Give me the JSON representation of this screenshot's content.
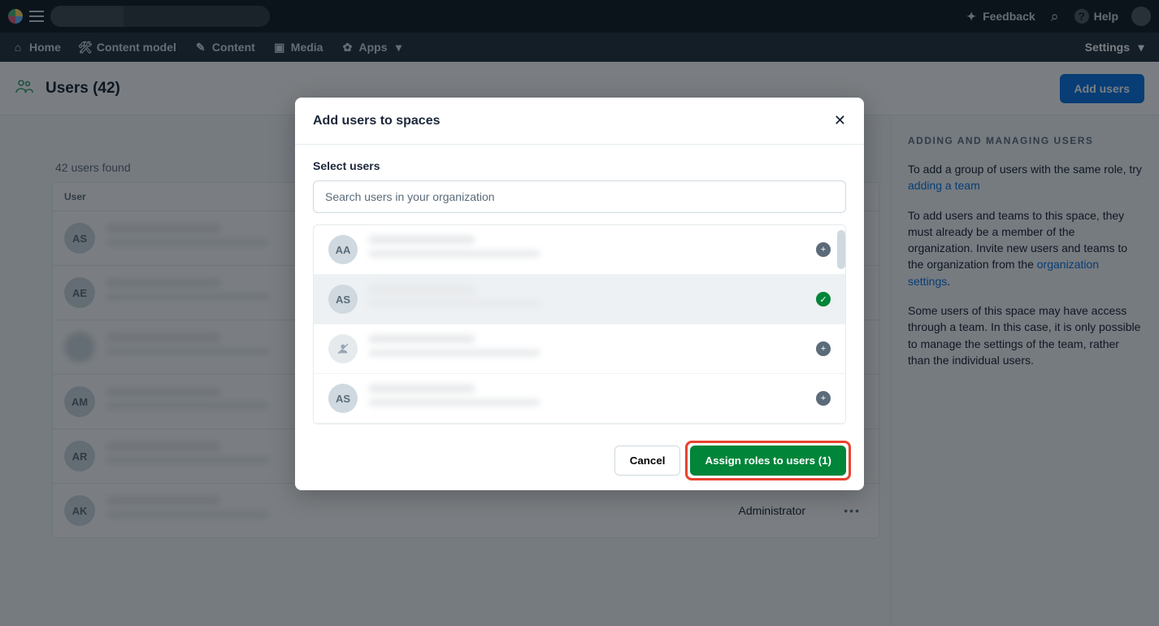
{
  "topbar": {
    "feedback": "Feedback",
    "help": "Help"
  },
  "secnav": {
    "home": "Home",
    "content_model": "Content model",
    "content": "Content",
    "media": "Media",
    "apps": "Apps",
    "settings": "Settings"
  },
  "page": {
    "title": "Users (42)",
    "add_users_btn": "Add users",
    "found": "42 users found",
    "col_user": "User"
  },
  "bg_users": [
    {
      "initials": "AS"
    },
    {
      "initials": "AE"
    },
    {
      "initials": ""
    },
    {
      "initials": "AM"
    },
    {
      "initials": "AR"
    },
    {
      "initials": "AK",
      "role": "Administrator"
    }
  ],
  "modal": {
    "title": "Add users to spaces",
    "select_label": "Select users",
    "search_placeholder": "Search users in your organization",
    "cancel": "Cancel",
    "assign": "Assign roles to users (1)",
    "list": [
      {
        "initials": "AA",
        "selected": false,
        "nouser": false
      },
      {
        "initials": "AS",
        "selected": true,
        "nouser": false
      },
      {
        "initials": "",
        "selected": false,
        "nouser": true
      },
      {
        "initials": "AS",
        "selected": false,
        "nouser": false
      }
    ]
  },
  "sidebar": {
    "heading": "ADDING AND MANAGING USERS",
    "p1a": "To add a group of users with the same role, try ",
    "p1_link": "adding a team",
    "p2a": "To add users and teams to this space, they must already be a member of the organization. Invite new users and teams to the organization from the ",
    "p2_link": "organization settings",
    "p2b": ".",
    "p3": "Some users of this space may have access through a team. In this case, it is only possible to manage the settings of the team, rather than the individual users."
  }
}
